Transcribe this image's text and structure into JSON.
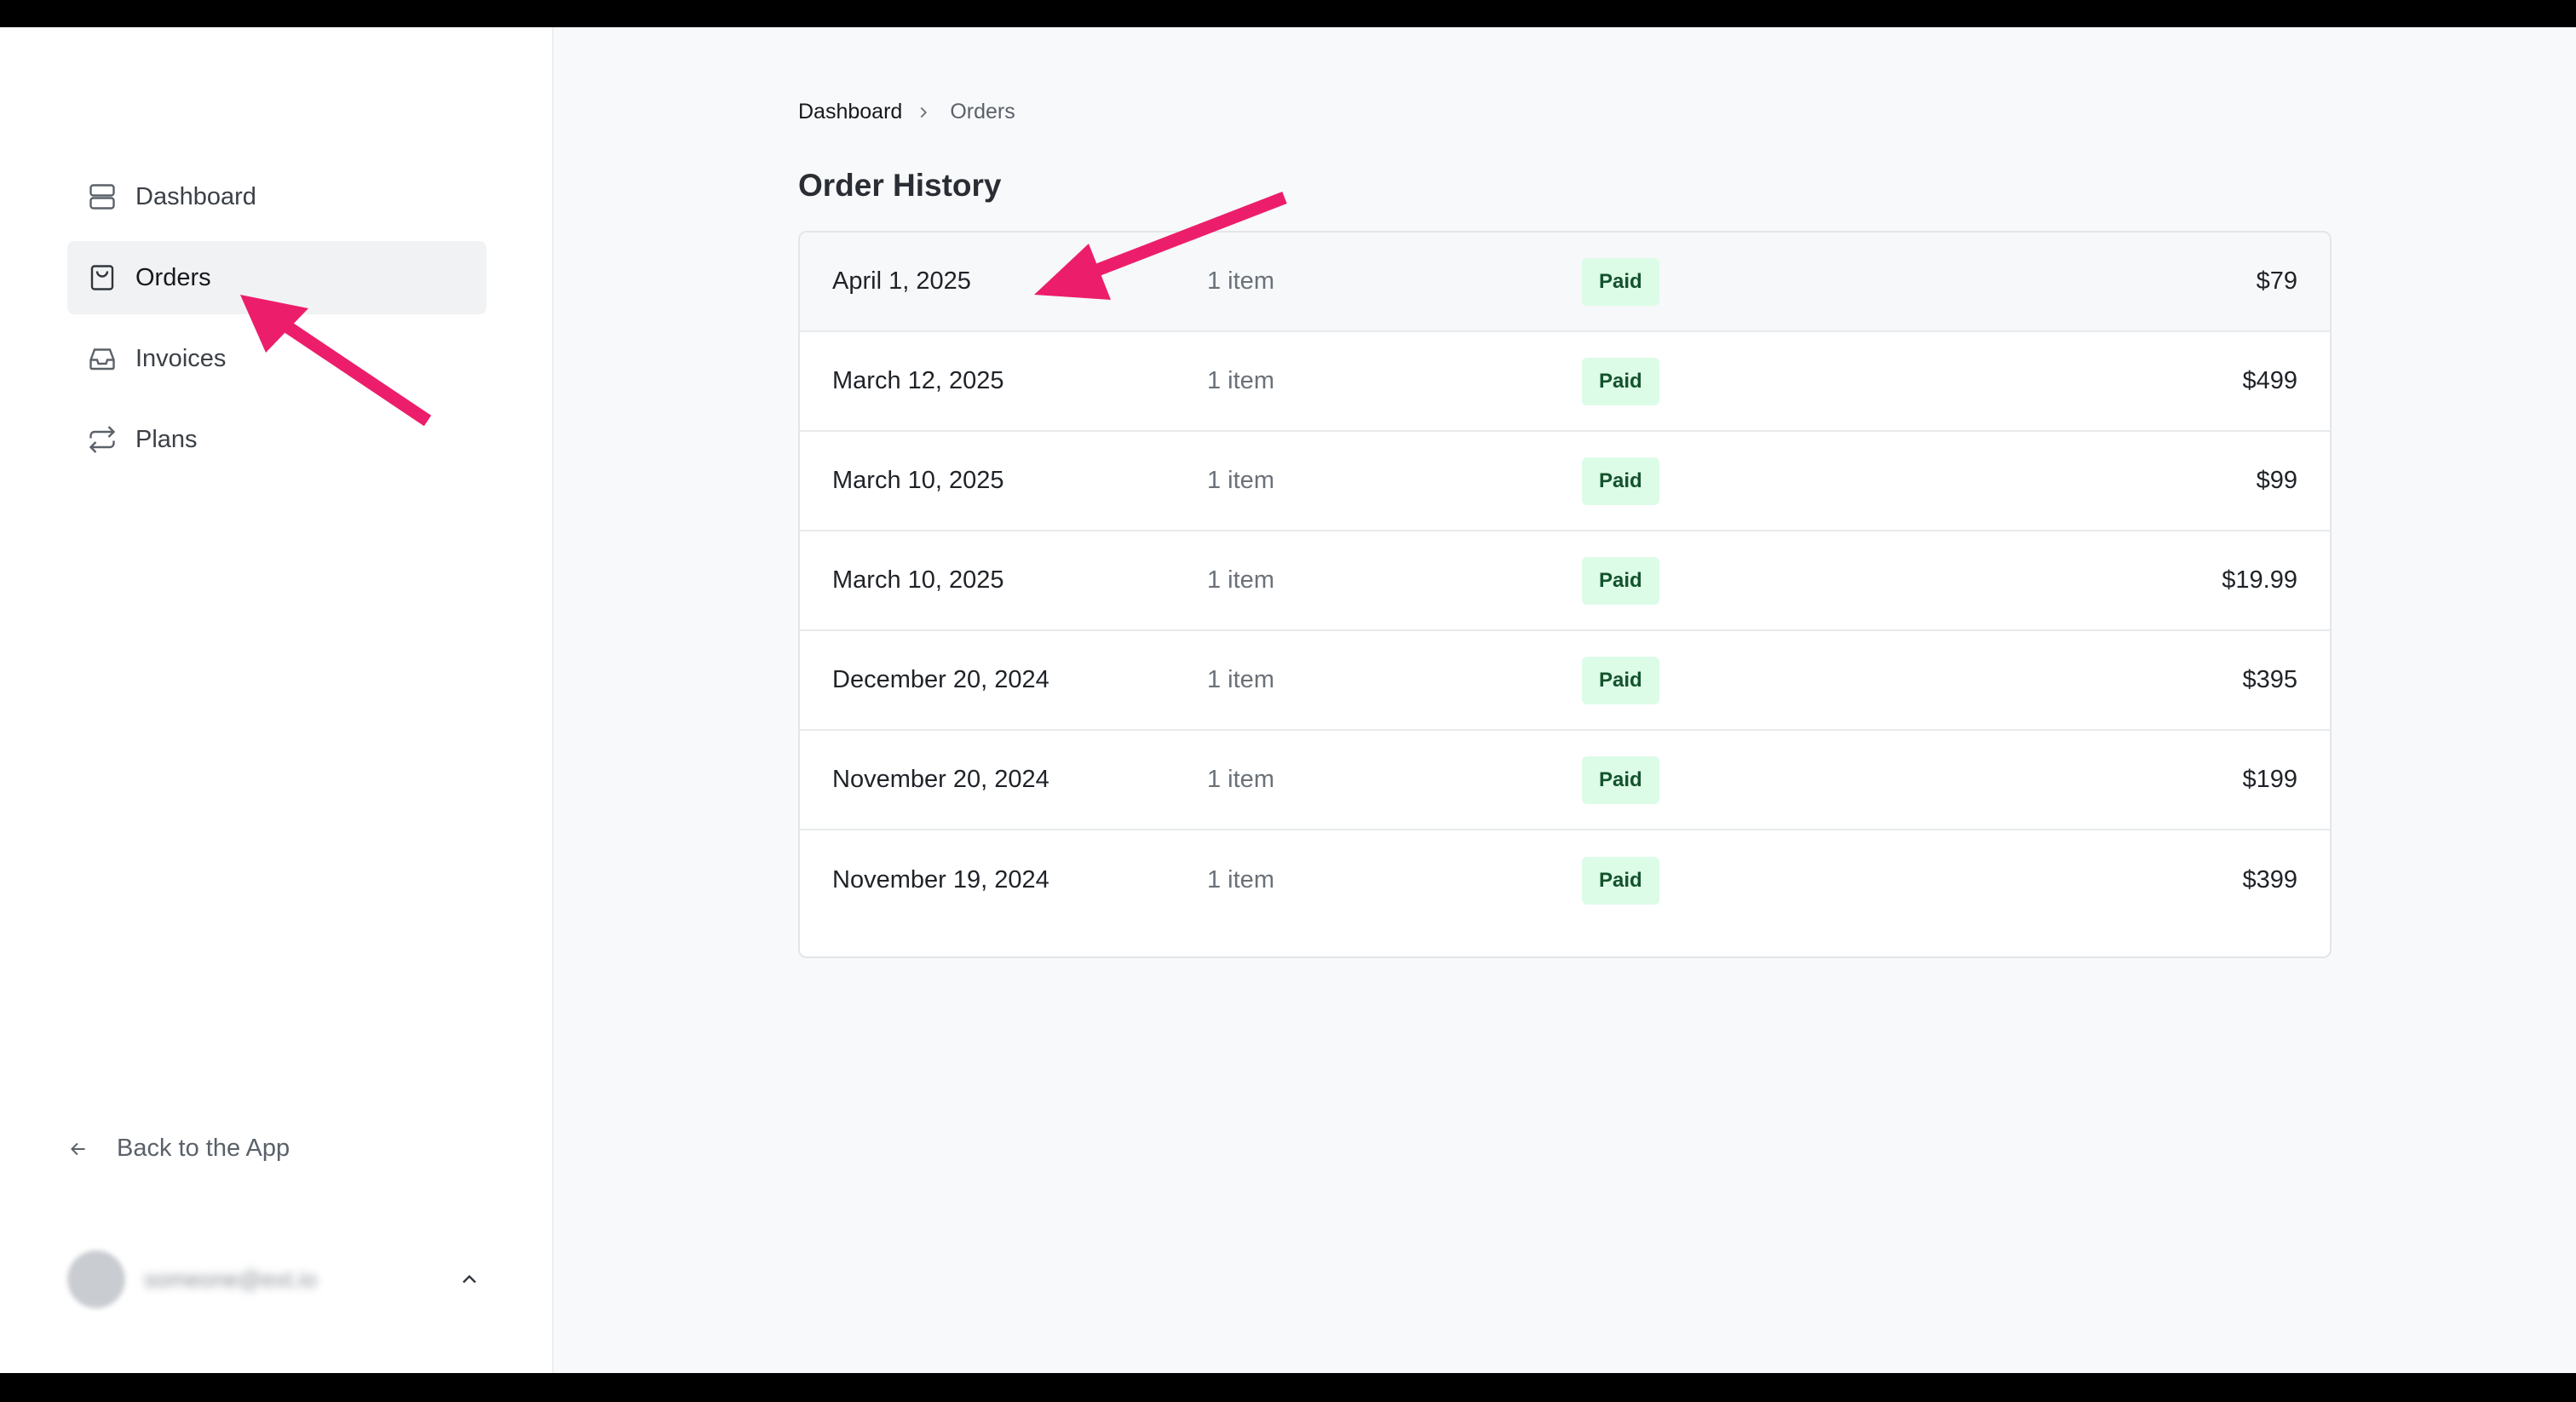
{
  "sidebar": {
    "items": [
      {
        "label": "Dashboard",
        "icon": "server-icon",
        "active": false
      },
      {
        "label": "Orders",
        "icon": "shopping-bag-icon",
        "active": true
      },
      {
        "label": "Invoices",
        "icon": "inbox-icon",
        "active": false
      },
      {
        "label": "Plans",
        "icon": "repeat-icon",
        "active": false
      }
    ],
    "back_label": "Back to the App",
    "user": {
      "email": "someone@ext.io",
      "avatar": "avatar-placeholder"
    }
  },
  "breadcrumb": {
    "home": "Dashboard",
    "current": "Orders"
  },
  "page": {
    "title": "Order History"
  },
  "orders": {
    "rows": [
      {
        "date": "April 1, 2025",
        "items": "1 item",
        "status": "Paid",
        "amount": "$79"
      },
      {
        "date": "March 12, 2025",
        "items": "1 item",
        "status": "Paid",
        "amount": "$499"
      },
      {
        "date": "March 10, 2025",
        "items": "1 item",
        "status": "Paid",
        "amount": "$99"
      },
      {
        "date": "March 10, 2025",
        "items": "1 item",
        "status": "Paid",
        "amount": "$19.99"
      },
      {
        "date": "December 20, 2024",
        "items": "1 item",
        "status": "Paid",
        "amount": "$395"
      },
      {
        "date": "November 20, 2024",
        "items": "1 item",
        "status": "Paid",
        "amount": "$199"
      },
      {
        "date": "November 19, 2024",
        "items": "1 item",
        "status": "Paid",
        "amount": "$399"
      }
    ]
  },
  "colors": {
    "annotation_arrow": "#ec1e6b",
    "paid_badge_bg": "#dcfce7",
    "paid_badge_text": "#14532d",
    "active_nav_bg": "#f1f2f4"
  }
}
